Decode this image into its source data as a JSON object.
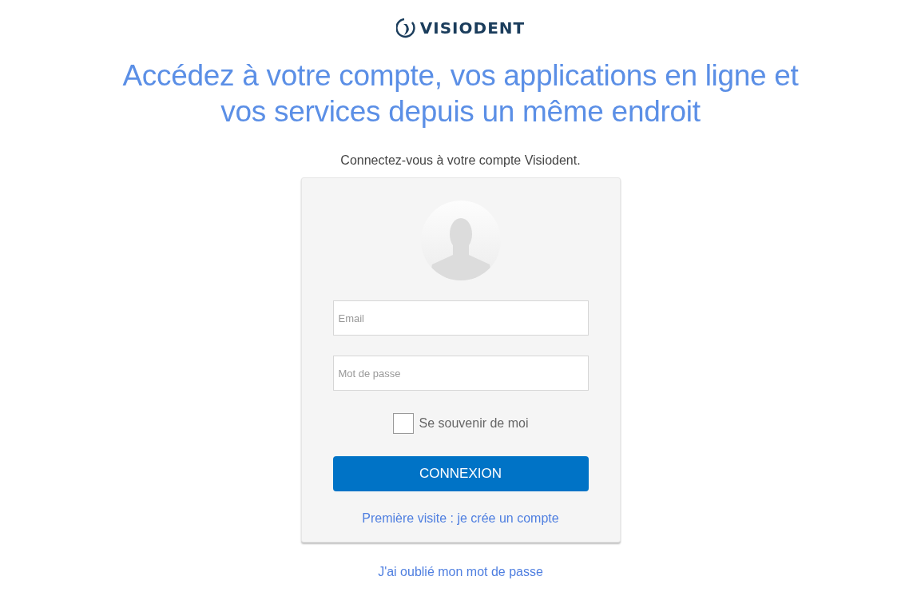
{
  "logo": {
    "text": "VISIODENT"
  },
  "heading_lines": [
    "Accédez à votre compte, vos applications en ligne et",
    "vos services depuis un même endroit"
  ],
  "subtitle": "Connectez-vous à votre compte Visiodent.",
  "login_card": {
    "avatar": {
      "kind": "silhouette"
    },
    "email": {
      "placeholder": "Email"
    },
    "password": {
      "placeholder": "Mot de passe"
    },
    "remember": {
      "label": "Se souvenir de moi",
      "checked": false
    },
    "submit": "CONNEXION",
    "signup_link": "Première visite : je crée un compte"
  },
  "forgot_link": "J'ai oublié mon mot de passe"
}
